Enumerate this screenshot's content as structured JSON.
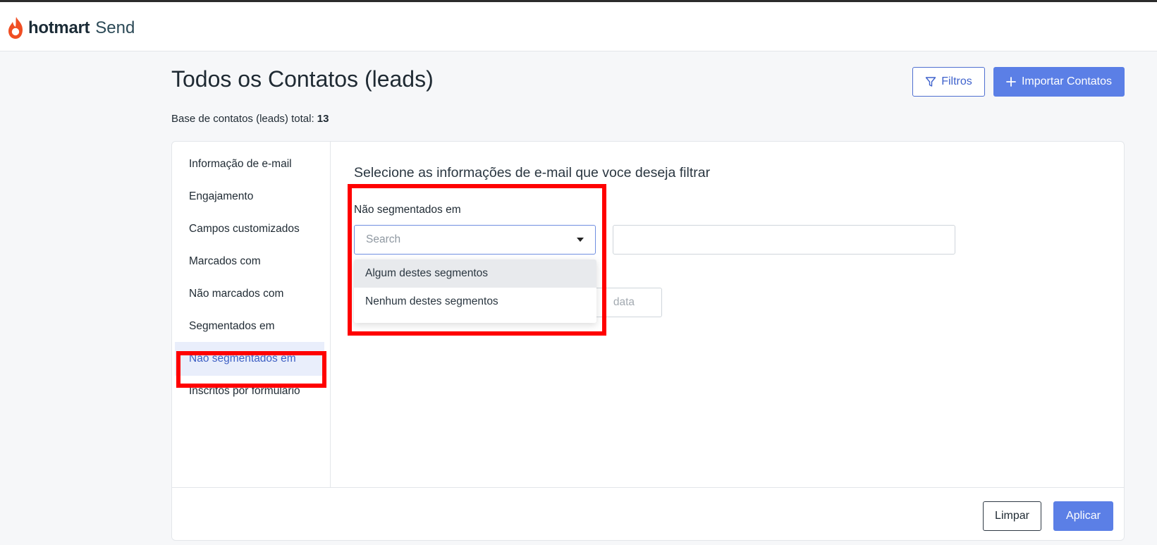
{
  "header": {
    "brand": "hotmart",
    "product": "Send"
  },
  "page": {
    "title": "Todos os Contatos (leads)",
    "filters_label": "Filtros",
    "import_label": "Importar Contatos",
    "total_label": "Base de contatos (leads) total:",
    "total_value": "13"
  },
  "sidebar": {
    "items": [
      {
        "label": "Informação de e-mail"
      },
      {
        "label": "Engajamento"
      },
      {
        "label": "Campos customizados"
      },
      {
        "label": "Marcados com"
      },
      {
        "label": "Não marcados com"
      },
      {
        "label": "Segmentados em"
      },
      {
        "label": "Não segmentados em"
      },
      {
        "label": "Inscritos por formulário"
      }
    ],
    "active_index": 6
  },
  "main": {
    "heading": "Selecione as informações de e-mail que voce deseja filtrar",
    "field_label": "Não segmentados em",
    "select_placeholder": "Search",
    "options": [
      {
        "label": "Algum destes segmentos"
      },
      {
        "label": "Nenhum destes segmentos"
      }
    ],
    "date_placeholder": "data"
  },
  "footer": {
    "clear_label": "Limpar",
    "apply_label": "Aplicar"
  },
  "colors": {
    "accent": "#5b7fe6",
    "highlight": "#ff0000",
    "brand_flame": "#f04e23"
  }
}
